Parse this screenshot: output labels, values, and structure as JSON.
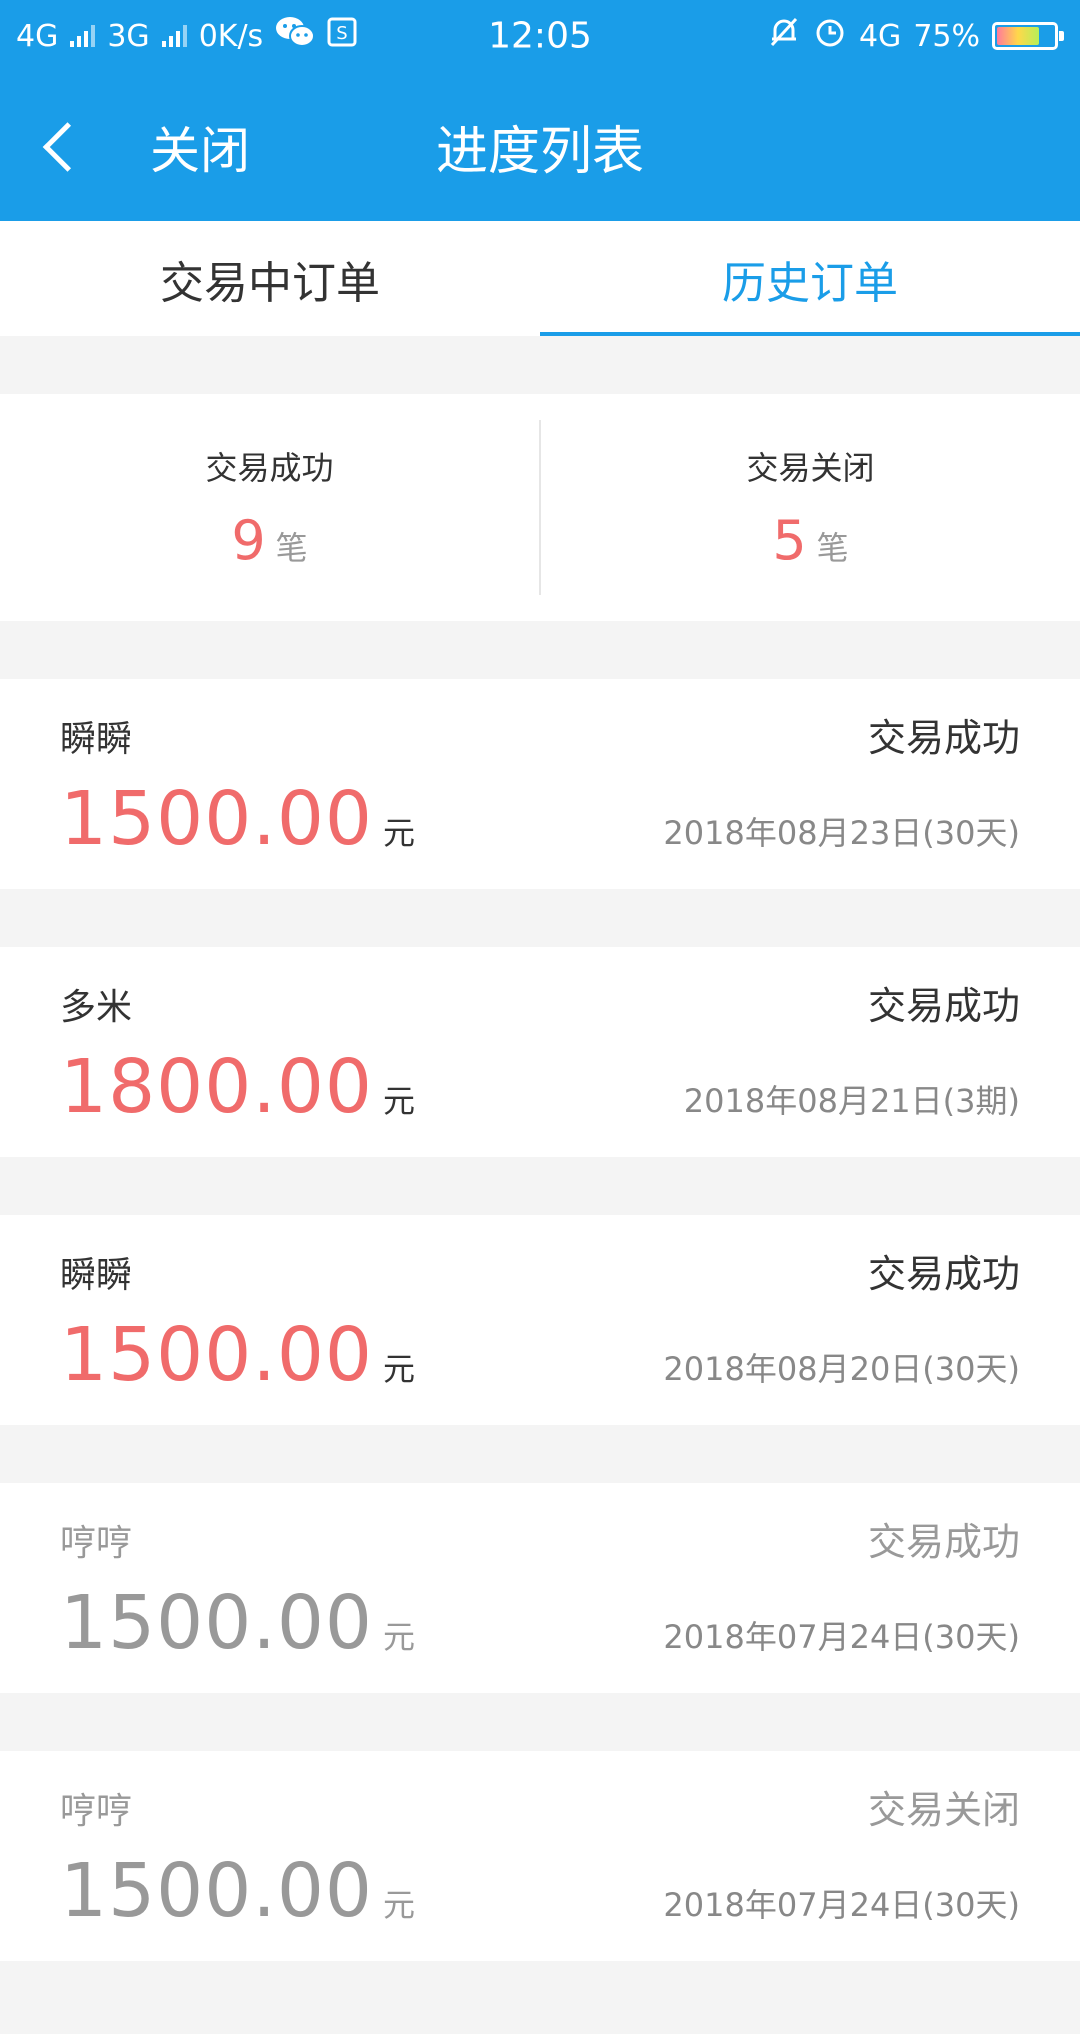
{
  "status_bar": {
    "network1": "4G",
    "network2": "3G",
    "speed": "0K/s",
    "time": "12:05",
    "network3": "4G",
    "battery_percent": "75%",
    "battery_level": 0.75
  },
  "navbar": {
    "close_label": "关闭",
    "title": "进度列表"
  },
  "tabs": [
    {
      "label": "交易中订单",
      "active": false
    },
    {
      "label": "历史订单",
      "active": true
    }
  ],
  "summary": {
    "success": {
      "label": "交易成功",
      "count": "9",
      "unit": "笔"
    },
    "closed": {
      "label": "交易关闭",
      "count": "5",
      "unit": "笔"
    }
  },
  "orders": [
    {
      "name": "瞬瞬",
      "status": "交易成功",
      "amount": "1500.00",
      "unit": "元",
      "date": "2018年08月23日(30天)",
      "muted": false
    },
    {
      "name": "多米",
      "status": "交易成功",
      "amount": "1800.00",
      "unit": "元",
      "date": "2018年08月21日(3期)",
      "muted": false
    },
    {
      "name": "瞬瞬",
      "status": "交易成功",
      "amount": "1500.00",
      "unit": "元",
      "date": "2018年08月20日(30天)",
      "muted": false
    },
    {
      "name": "哼哼",
      "status": "交易成功",
      "amount": "1500.00",
      "unit": "元",
      "date": "2018年07月24日(30天)",
      "muted": true
    },
    {
      "name": "哼哼",
      "status": "交易关闭",
      "amount": "1500.00",
      "unit": "元",
      "date": "2018年07月24日(30天)",
      "muted": true
    }
  ],
  "colors": {
    "primary": "#1a9de8",
    "amount": "#f06b6b",
    "muted": "#999999"
  }
}
